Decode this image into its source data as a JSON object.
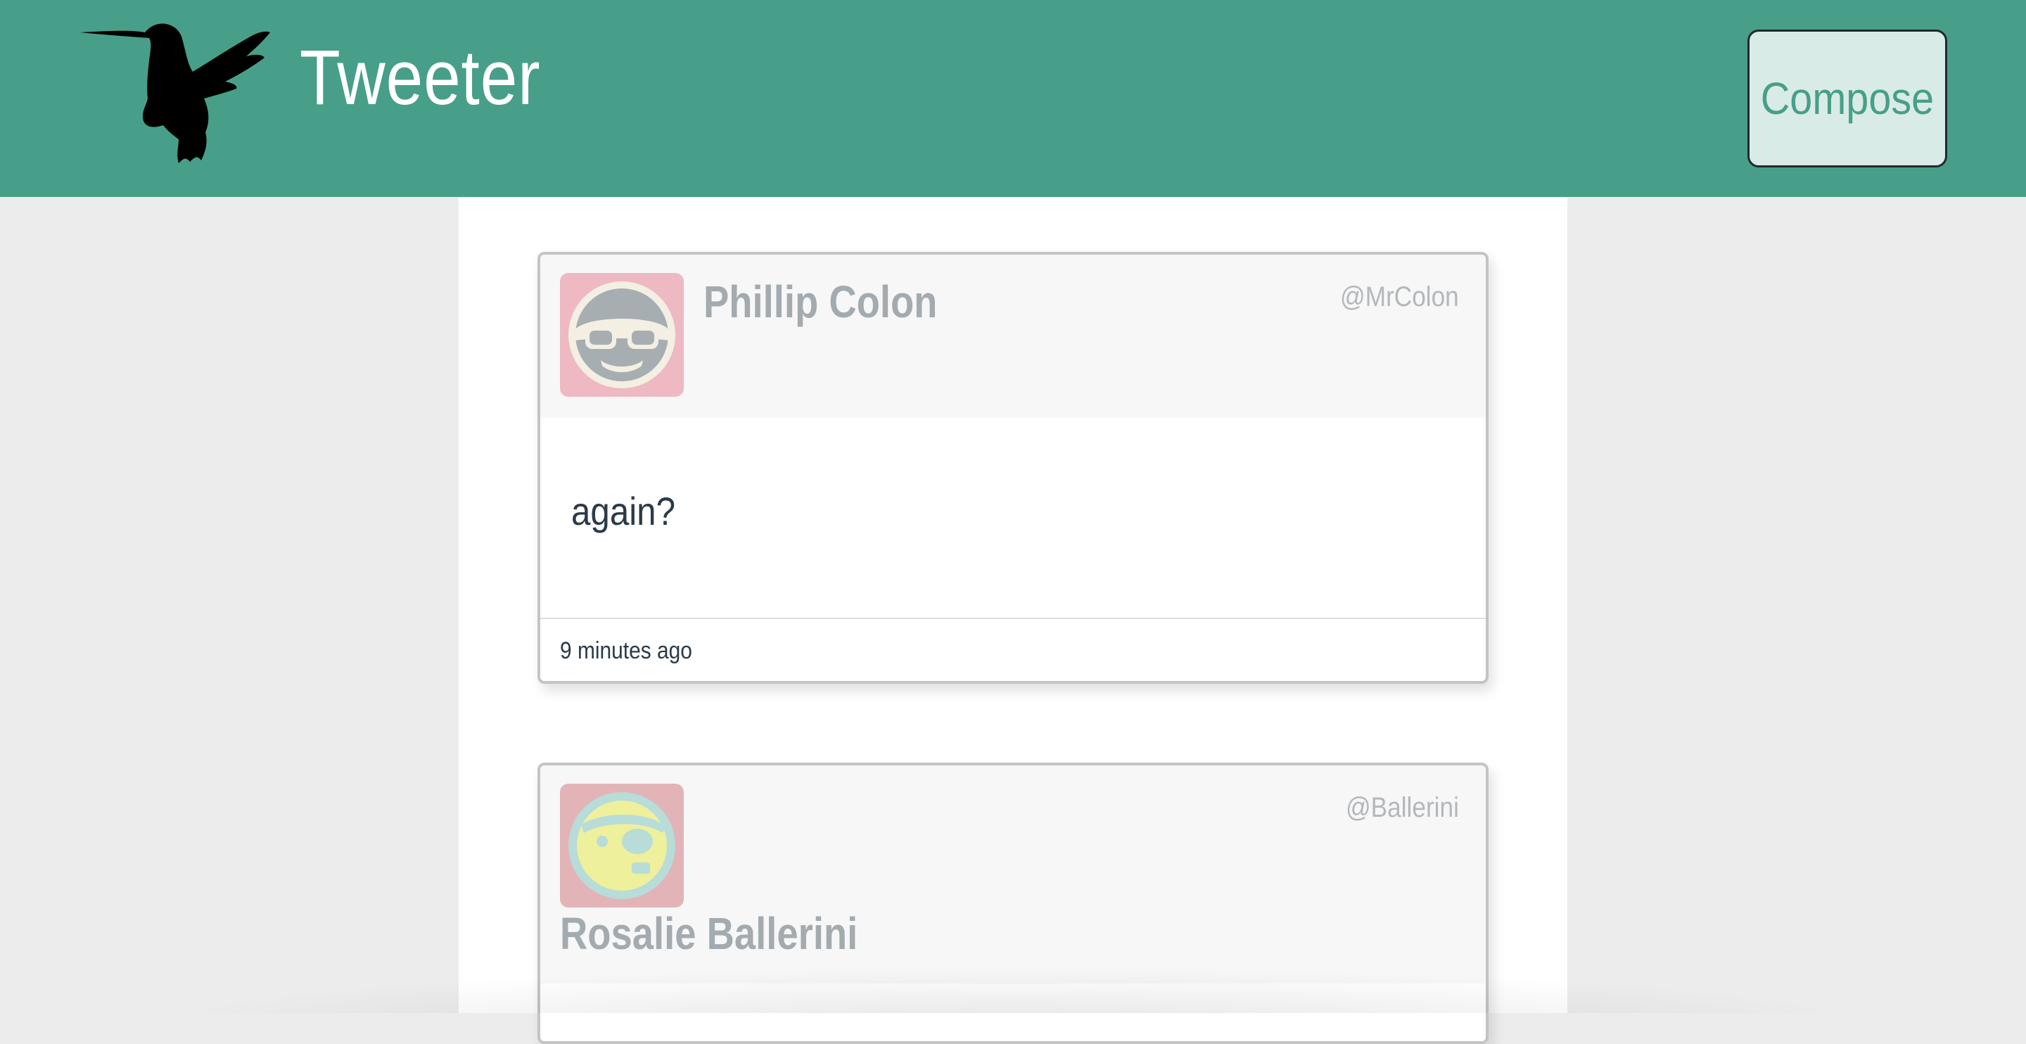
{
  "header": {
    "brand": "Tweeter",
    "logo_icon": "hummingbird-icon",
    "compose_label": "Compose"
  },
  "colors": {
    "navbar": "#479f89",
    "compose_bg": "#d9ebe6",
    "page_bg": "#ececec"
  },
  "tweets": [
    {
      "name": "Phillip Colon",
      "handle": "@MrColon",
      "avatar_icon": "avatar-sunglasses-face-icon",
      "text": "again?",
      "time": "9 minutes ago"
    },
    {
      "name": "Rosalie Ballerini",
      "handle": "@Ballerini",
      "avatar_icon": "avatar-eyepatch-face-icon",
      "text": "",
      "time": ""
    }
  ]
}
